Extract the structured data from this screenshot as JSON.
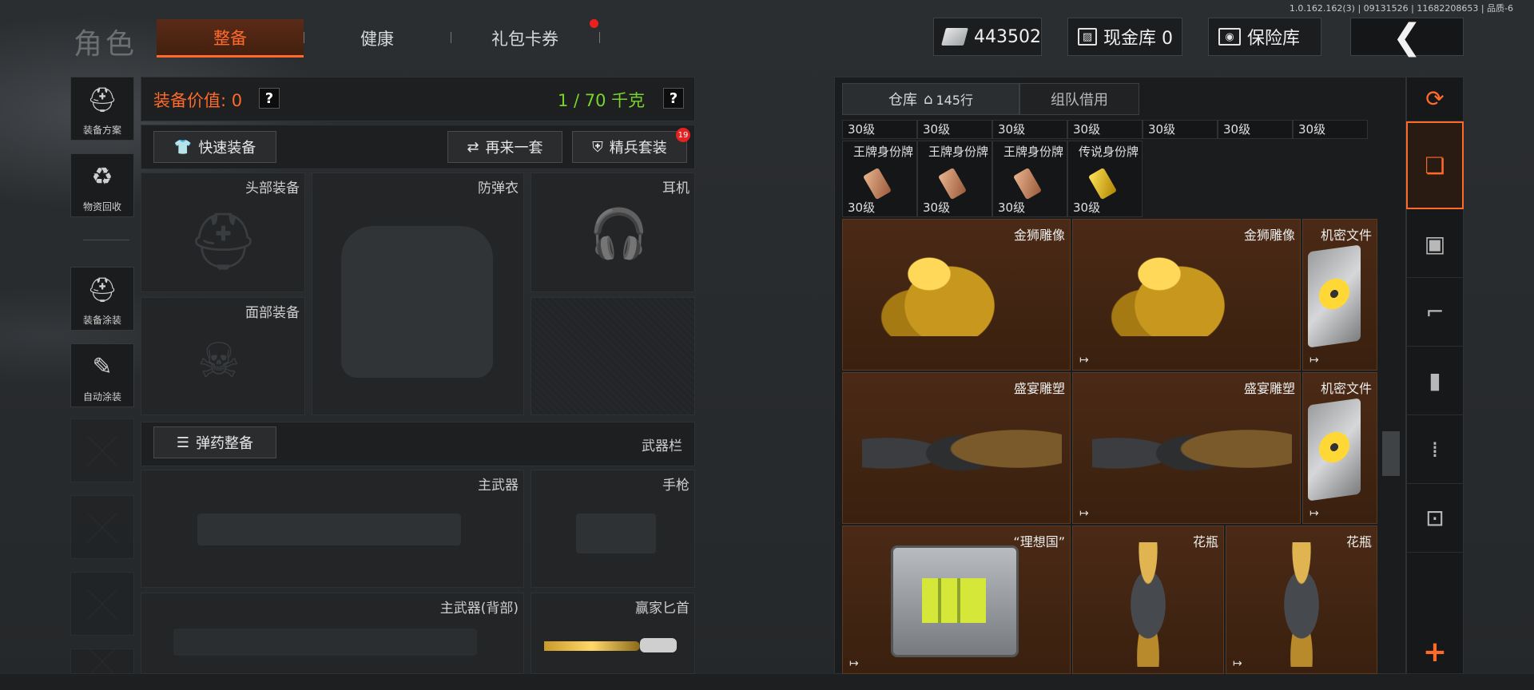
{
  "build_info": "1.0.162.162(3) | 09131526 | 11682208653 | 品质-6",
  "header": {
    "title": "角色",
    "tabs": [
      {
        "label": "整备",
        "active": true
      },
      {
        "label": "健康",
        "active": false
      },
      {
        "label": "礼包卡券",
        "active": false,
        "notification_dot": true
      }
    ],
    "currency": "443502",
    "cash_vault_label": "现金库 0",
    "safe_label": "保险库",
    "back_icon": "chevron-left-icon"
  },
  "sidebar": {
    "items": [
      {
        "label": "装备方案",
        "icon": "helmet-plan-icon"
      },
      {
        "label": "物资回收",
        "icon": "recycle-icon"
      },
      {
        "label": "装备涂装",
        "icon": "paint-helmet-icon"
      },
      {
        "label": "自动涂装",
        "icon": "brush-gear-icon"
      }
    ]
  },
  "loadout": {
    "value_label": "装备价值: 0",
    "weight_label": "1 / 70 千克",
    "quick_equip": "快速装备",
    "again_label": "再来一套",
    "elite_label": "精兵套装",
    "elite_badge": "19",
    "slots": {
      "head": "头部装备",
      "armor": "防弹衣",
      "headset": "耳机",
      "face": "面部装备",
      "ammo_btn": "弹药整备",
      "weapon_bar": "武器栏",
      "primary": "主武器",
      "pistol": "手枪",
      "primary_back": "主武器(背部)",
      "melee": "赢家匕首"
    },
    "question_mark": "?"
  },
  "warehouse": {
    "tab_label": "仓库",
    "rows_label": "145行",
    "team_label": "组队借用",
    "top_row_level": "30级",
    "tags": [
      {
        "name": "王牌身份牌",
        "level": "30级",
        "type": "bronze"
      },
      {
        "name": "王牌身份牌",
        "level": "30级",
        "type": "bronze"
      },
      {
        "name": "王牌身份牌",
        "level": "30级",
        "type": "bronze"
      },
      {
        "name": "传说身份牌",
        "level": "30级",
        "type": "gold"
      }
    ],
    "items": [
      {
        "name": "金狮雕像"
      },
      {
        "name": "金狮雕像"
      },
      {
        "name": "机密文件"
      },
      {
        "name": "盛宴雕塑"
      },
      {
        "name": "盛宴雕塑"
      },
      {
        "name": "机密文件"
      },
      {
        "name": "“理想国”"
      },
      {
        "name": "花瓶"
      },
      {
        "name": "花瓶"
      }
    ],
    "export_icon": "↦"
  },
  "right_tabs": [
    "stack-refresh-icon",
    "stack-icon",
    "vest-icon",
    "rifle-icon",
    "magazine-icon",
    "ammo-icon",
    "scope-icon",
    "plus-icon"
  ],
  "colors": {
    "accent": "#ff6a2b",
    "weight": "#7ad32b",
    "alert": "#e52222"
  }
}
